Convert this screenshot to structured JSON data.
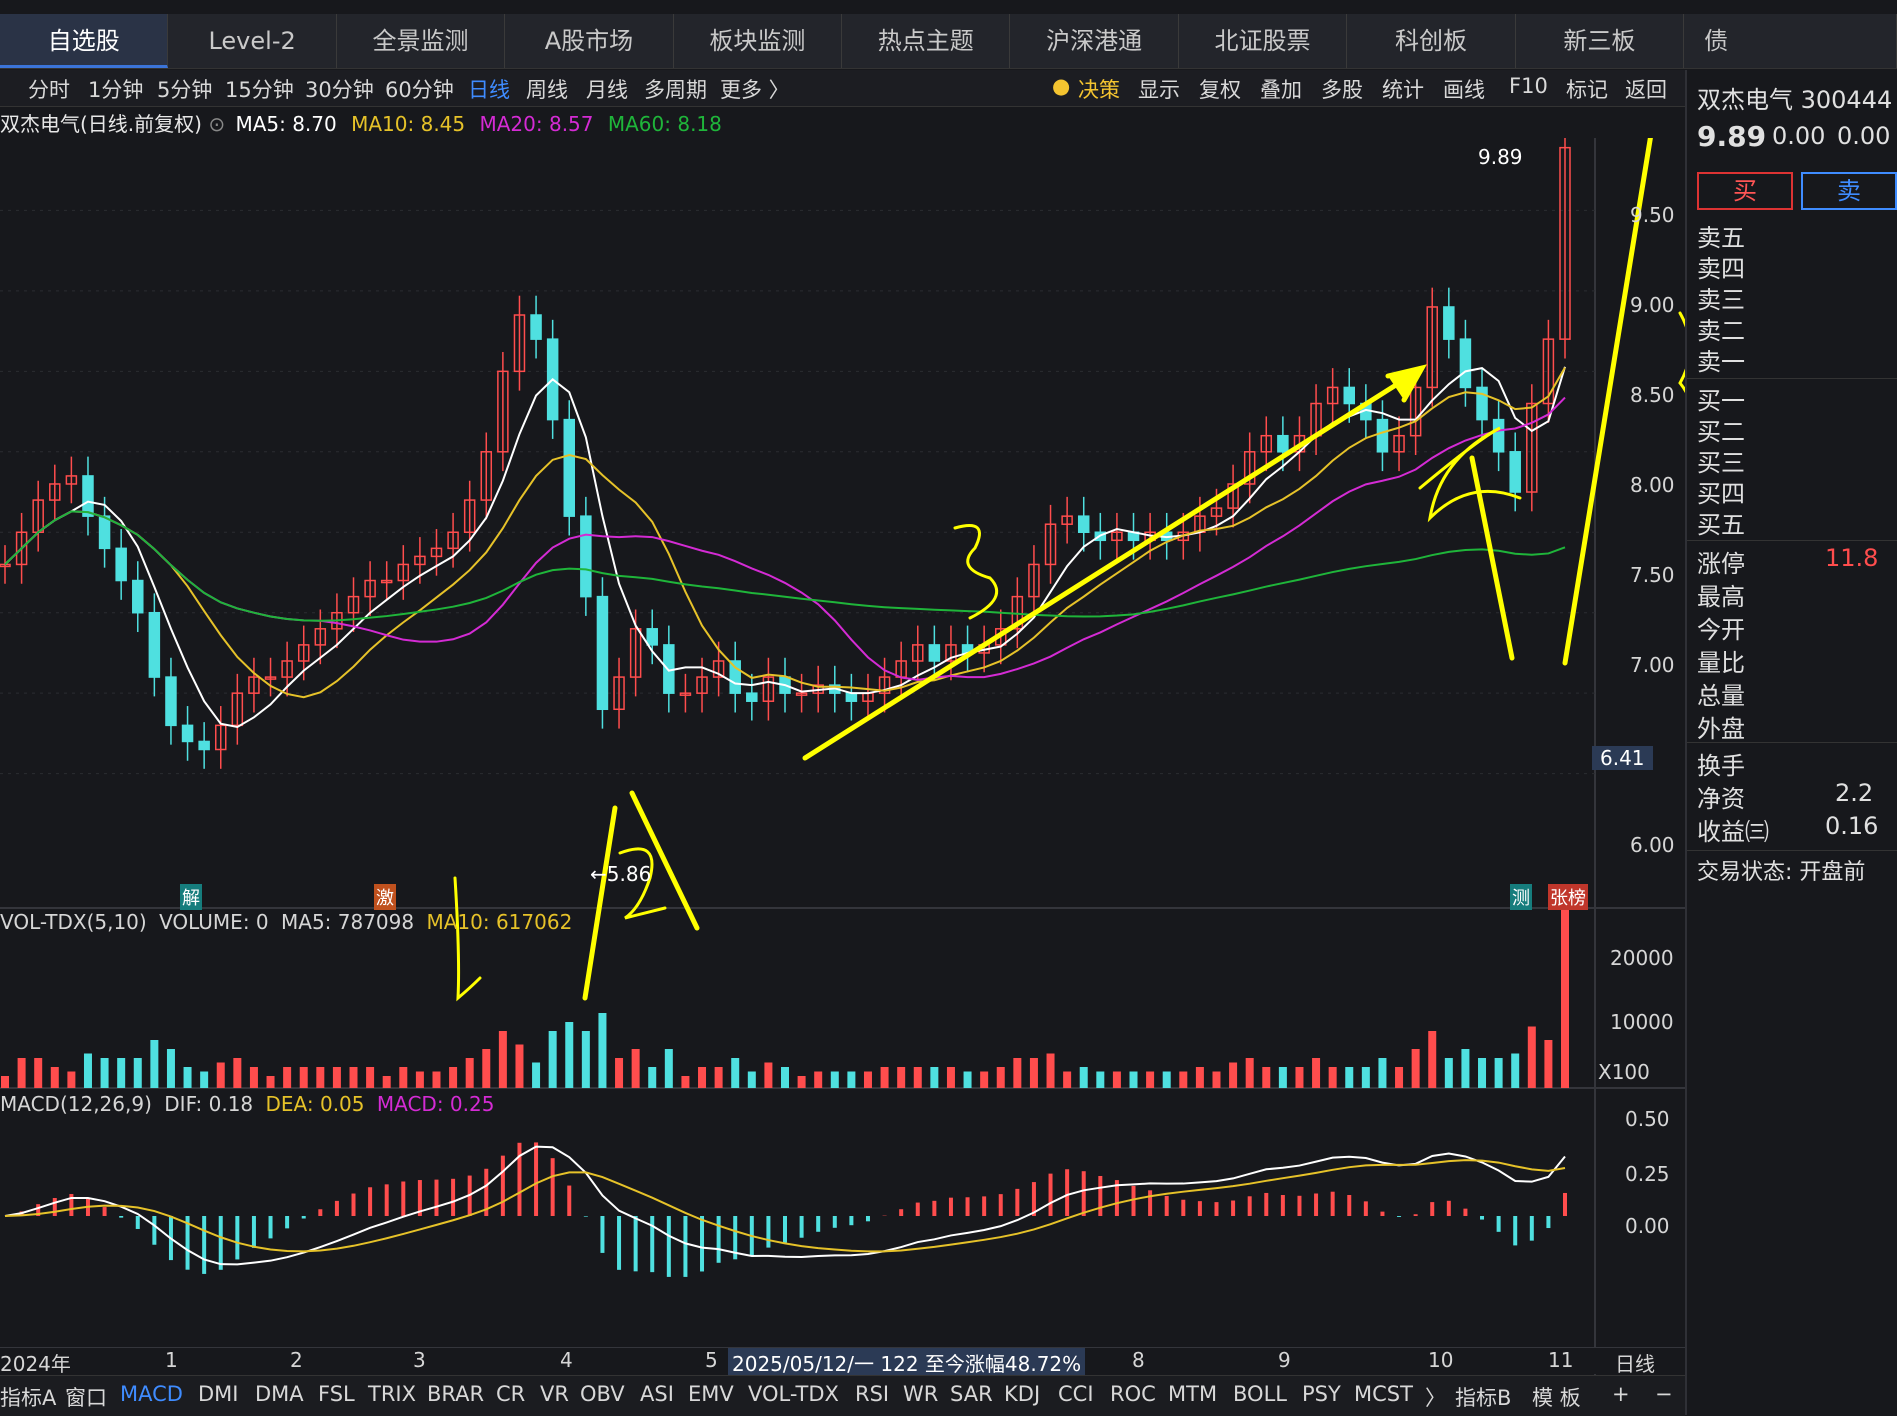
{
  "top_tabs": [
    "自选股",
    "Level-2",
    "全景监测",
    "A股市场",
    "板块监测",
    "热点主题",
    "沪深港通",
    "北证股票",
    "科创板",
    "新三板",
    "债"
  ],
  "period_tabs": [
    "分时",
    "1分钟",
    "5分钟",
    "15分钟",
    "30分钟",
    "60分钟",
    "日线",
    "周线",
    "月线",
    "多周期",
    "更多 〉"
  ],
  "tools": [
    "决策",
    "显示",
    "复权",
    "叠加",
    "多股",
    "统计",
    "画线",
    "F10",
    "标记",
    "返回"
  ],
  "stock": {
    "title": "双杰电气(日线.前复权)",
    "name_code": "双杰电气 300444",
    "price": "9.89",
    "change": "0.00",
    "pct": "0.00"
  },
  "ma": {
    "ma5": "MA5: 8.70",
    "ma10": "MA10: 8.45",
    "ma20": "MA20: 8.57",
    "ma60": "MA60: 8.18"
  },
  "price_axis": [
    "9.50",
    "9.00",
    "8.50",
    "8.00",
    "7.50",
    "7.00",
    "6.00"
  ],
  "price_marker": "6.41",
  "high_label": "9.89",
  "low_label": "←5.86",
  "event_tags": {
    "unlock": "解",
    "surge": "激",
    "test": "测",
    "zt": "张榜"
  },
  "vol": {
    "title": "VOL-TDX(5,10)",
    "volume": "VOLUME: 0",
    "ma5": "MA5: 787098",
    "ma10": "MA10: 617062",
    "axis": [
      "20000",
      "10000",
      "X100"
    ]
  },
  "macd": {
    "title": "MACD(12,26,9)",
    "dif": "DIF: 0.18",
    "dea": "DEA: 0.05",
    "macd": "MACD: 0.25",
    "axis": [
      "0.50",
      "0.25",
      "0.00"
    ]
  },
  "date_axis": [
    "2024年",
    "1",
    "2",
    "3",
    "4",
    "5",
    "8",
    "9",
    "10",
    "11"
  ],
  "range_text": "2025/05/12/一 122 至今涨幅48.72%",
  "period_label": "日线",
  "buttons": {
    "buy": "买",
    "sell": "卖"
  },
  "order_book": [
    "卖五",
    "卖四",
    "卖三",
    "卖二",
    "卖一",
    "买一",
    "买二",
    "买三",
    "买四",
    "买五"
  ],
  "stats": [
    {
      "label": "涨停",
      "value": "11.8"
    },
    {
      "label": "最高",
      "value": ""
    },
    {
      "label": "今开",
      "value": ""
    },
    {
      "label": "量比",
      "value": ""
    },
    {
      "label": "总量",
      "value": ""
    },
    {
      "label": "外盘",
      "value": ""
    },
    {
      "label": "换手",
      "value": ""
    },
    {
      "label": "净资",
      "value": "2.2"
    },
    {
      "label": "收益㈢",
      "value": "0.16"
    }
  ],
  "trade_status": "交易状态: 开盘前",
  "indicators": [
    "指标A",
    "窗口",
    "MACD",
    "DMI",
    "DMA",
    "FSL",
    "TRIX",
    "BRAR",
    "CR",
    "VR",
    "OBV",
    "ASI",
    "EMV",
    "VOL-TDX",
    "RSI",
    "WR",
    "SAR",
    "KDJ",
    "CCI",
    "ROC",
    "MTM",
    "BOLL",
    "PSY",
    "MCST",
    "〉",
    "指标B",
    "模 板",
    "+",
    "−"
  ],
  "colors": {
    "up": "#ff4d4d",
    "down": "#4fe0e0",
    "ma5": "#ffffff",
    "ma10": "#e6c229",
    "ma20": "#d42bd4",
    "ma60": "#1fb53a",
    "annot": "#ffff00"
  },
  "chart_data": {
    "type": "candlestick",
    "ylim": [
      5.6,
      9.95
    ],
    "high": 9.89,
    "low": 5.86,
    "close_series": [
      7.3,
      7.5,
      7.7,
      7.8,
      7.85,
      7.6,
      7.4,
      7.2,
      7.0,
      6.6,
      6.3,
      6.2,
      6.15,
      6.3,
      6.5,
      6.6,
      6.6,
      6.7,
      6.8,
      6.9,
      7.0,
      7.1,
      7.2,
      7.2,
      7.3,
      7.35,
      7.4,
      7.5,
      7.7,
      8.0,
      8.5,
      8.85,
      8.7,
      8.2,
      7.6,
      7.1,
      6.4,
      6.6,
      6.9,
      6.8,
      6.5,
      6.5,
      6.6,
      6.7,
      6.5,
      6.45,
      6.6,
      6.5,
      6.5,
      6.55,
      6.5,
      6.45,
      6.5,
      6.6,
      6.7,
      6.8,
      6.7,
      6.8,
      6.75,
      6.8,
      6.9,
      7.1,
      7.3,
      7.55,
      7.6,
      7.5,
      7.45,
      7.5,
      7.45,
      7.5,
      7.45,
      7.5,
      7.6,
      7.65,
      7.8,
      8.0,
      8.1,
      8.0,
      8.1,
      8.3,
      8.4,
      8.3,
      8.2,
      8.0,
      8.1,
      8.4,
      8.9,
      8.7,
      8.4,
      8.2,
      8.0,
      7.75,
      8.3,
      8.7,
      9.89
    ]
  }
}
